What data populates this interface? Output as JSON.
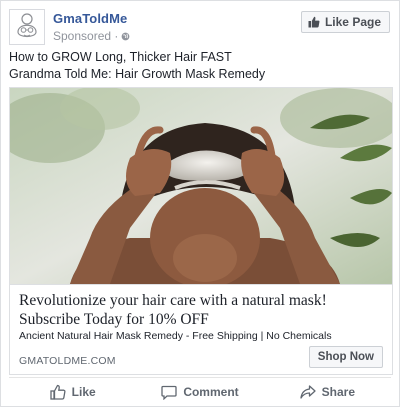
{
  "post": {
    "page_name": "GmaToldMe",
    "sponsored_label": "Sponsored ·",
    "like_page_label": "Like Page",
    "text_lines": [
      "How to GROW Long, Thicker Hair FAST",
      "Grandma Told Me: Hair Growth Mask Remedy"
    ]
  },
  "ad": {
    "headline": "Revolutionize your hair care with a natural mask! Subscribe Today for 10% OFF",
    "description": "Ancient Natural Hair Mask Remedy - Free Shipping | No Chemicals",
    "domain": "GMATOLDME.COM",
    "cta_label": "Shop Now"
  },
  "actions": {
    "like_label": "Like",
    "comment_label": "Comment",
    "share_label": "Share"
  },
  "colors": {
    "brand_link": "#365899",
    "muted": "#90949c",
    "action_text": "#606770"
  },
  "icons": [
    "grandma-avatar-icon",
    "globe-icon",
    "thumbs-up-icon",
    "comment-icon",
    "share-icon"
  ]
}
